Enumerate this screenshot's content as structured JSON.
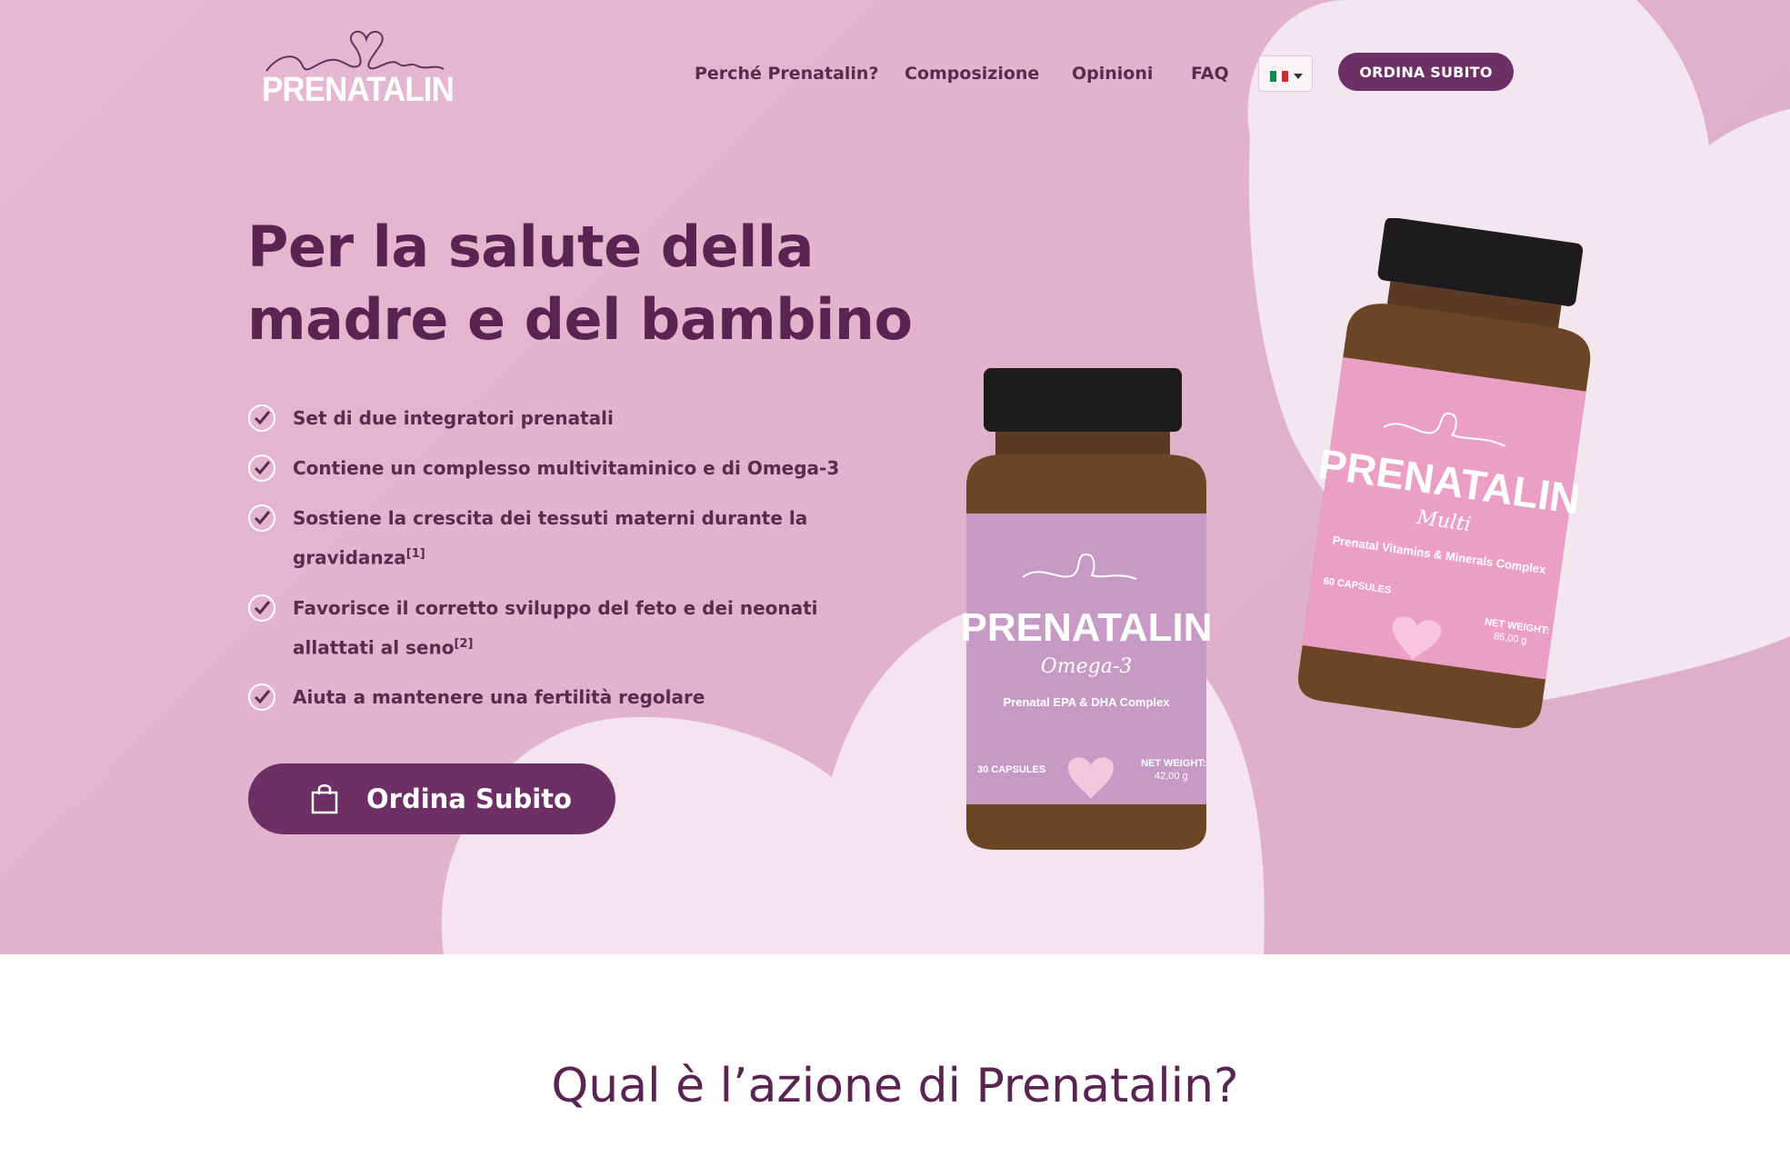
{
  "brand": {
    "logo_text": "PRENATALIN",
    "primary_color": "#6e2f66",
    "text_color": "#5a2352",
    "hero_background": "#e4b6cf"
  },
  "nav": {
    "links": [
      {
        "label": "Perché Prenatalin?"
      },
      {
        "label": "Composizione"
      },
      {
        "label": "Opinioni"
      },
      {
        "label": "FAQ"
      }
    ],
    "language": {
      "icon": "italy-flag-icon",
      "colors": [
        "#009246",
        "#ffffff",
        "#ce2b37"
      ]
    },
    "cta_label": "ORDINA SUBITO"
  },
  "hero": {
    "headline_line1": "Per la salute della",
    "headline_line2": "madre e del bambino",
    "benefits": [
      {
        "text": "Set di due integratori prenatali",
        "ref": ""
      },
      {
        "text": "Contiene un complesso multivitaminico e di Omega-3",
        "ref": ""
      },
      {
        "text": "Sostiene la crescita dei tessuti materni durante la gravidanza",
        "ref": "[1]"
      },
      {
        "text": "Favorisce il corretto sviluppo del feto e dei neonati allattati al seno",
        "ref": "[2]"
      },
      {
        "text": "Aiuta a mantenere una fertilità regolare",
        "ref": ""
      }
    ],
    "order_button_label": "Ordina Subito",
    "order_button_icon": "shopping-bag-icon"
  },
  "products": {
    "omega": {
      "brand": "PRENATALIN",
      "variant": "Omega-3",
      "subtitle": "Prenatal EPA & DHA Complex",
      "count": "30 CAPSULES",
      "weight_label": "NET WEIGHT:",
      "weight": "42,00 g",
      "label_color": "#c69ac4"
    },
    "multi": {
      "brand": "PRENATALIN",
      "variant": "Multi",
      "subtitle": "Prenatal Vitamins & Minerals Complex",
      "count": "60 CAPSULES",
      "weight_label": "NET WEIGHT:",
      "weight": "85,00 g",
      "label_color": "#ec9fc4"
    }
  },
  "section": {
    "title": "Qual è l’azione di Prenatalin?"
  }
}
